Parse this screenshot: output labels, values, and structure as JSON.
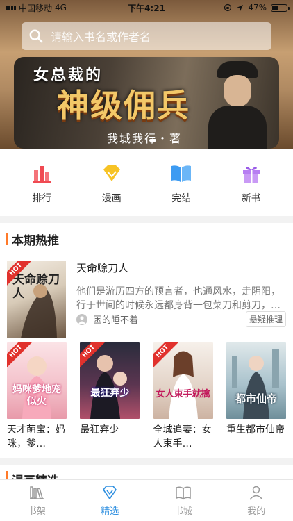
{
  "status": {
    "carrier": "中国移动",
    "network": "4G",
    "time": "下午4:21",
    "battery": "47%",
    "battery_level": 0.47
  },
  "search": {
    "placeholder": "请输入书名或作者名"
  },
  "banner": {
    "subtitle": "女总裁的",
    "title": "神级佣兵",
    "author": "我城我行・著"
  },
  "categories": [
    {
      "label": "排行",
      "icon": "bar-chart-icon"
    },
    {
      "label": "漫画",
      "icon": "diamond-icon"
    },
    {
      "label": "完结",
      "icon": "open-book-icon"
    },
    {
      "label": "新书",
      "icon": "gift-icon"
    }
  ],
  "hot_section": {
    "title": "本期热推",
    "featured": {
      "title": "天命赊刀人",
      "description": "他们是游历四方的预言者，也通风水，走阴阳，行于世间的时候永远都身背一包菜刀和剪刀，…",
      "author": "困的睡不着",
      "tag": "悬疑推理",
      "badge": "HOT",
      "cover_text": "天命赊刀人"
    },
    "books": [
      {
        "title": "天才萌宝：妈咪，爹…",
        "cover_text": "妈咪爹地宠似火",
        "badge": "HOT",
        "color": "#f4c6cf"
      },
      {
        "title": "最狂弃少",
        "cover_text": "最狂弃少",
        "badge": "HOT",
        "color": "#6a3a52"
      },
      {
        "title": "全城追妻：女人束手…",
        "cover_text": "女人束手就擒",
        "badge": "HOT",
        "color": "#d9c3b4"
      },
      {
        "title": "重生都市仙帝",
        "cover_text": "都市仙帝",
        "badge": "",
        "color": "#9fb8c2"
      }
    ]
  },
  "comic_section": {
    "title": "漫画精选"
  },
  "tabs": [
    {
      "label": "书架",
      "icon": "bookshelf-icon",
      "active": false
    },
    {
      "label": "精选",
      "icon": "featured-icon",
      "active": true
    },
    {
      "label": "书城",
      "icon": "bookstore-icon",
      "active": false
    },
    {
      "label": "我的",
      "icon": "profile-icon",
      "active": false
    }
  ],
  "colors": {
    "accent": "#2e8fe0",
    "section_bar": "#ff7a2a",
    "hot_badge": "#e1322d"
  }
}
